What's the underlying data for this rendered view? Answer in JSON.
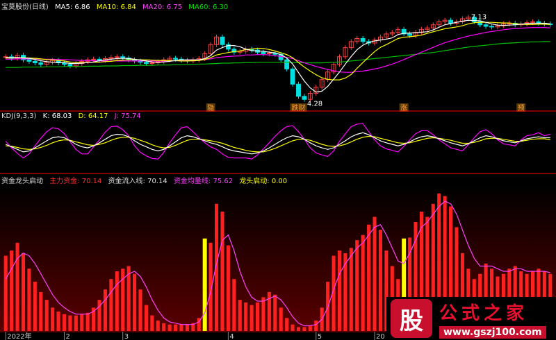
{
  "colors": {
    "up": "#ff4040",
    "down": "#00e0e0",
    "ma5": "#ffffff",
    "ma10": "#ffff00",
    "ma20": "#ff00ff",
    "ma60": "#00c000",
    "fund_bar": "#ff2020",
    "fund_line": "#ff40ff",
    "dragon": "#ffff00",
    "divider": "#ff0000"
  },
  "main_header": {
    "stock": "宝莫股份(日线)",
    "ma5": "MA5: 6.86",
    "ma10": "MA10: 6.84",
    "ma20": "MA20: 6.75",
    "ma60": "MA60: 6.30"
  },
  "kdj_header": {
    "name": "KDJ(9,3,3)",
    "k": "K: 68.03",
    "d": "D: 64.17",
    "j": "J: 75.74"
  },
  "fund_header": {
    "name": "资金龙头启动",
    "main": "主力资金: 70.14",
    "inflow": "资金流入线: 70.14",
    "avg": "资金均量线: 75.62",
    "dragon": "龙头启动: 0.00"
  },
  "watermark": {
    "logo_char": "股",
    "brand": "公式之家",
    "url": "www.gszj100.com"
  },
  "chart_data": [
    {
      "type": "line",
      "name": "price",
      "close": [
        5.8,
        5.75,
        5.85,
        5.7,
        5.65,
        5.6,
        5.55,
        5.62,
        5.68,
        5.6,
        5.55,
        5.5,
        5.58,
        5.65,
        5.7,
        5.72,
        5.68,
        5.74,
        5.78,
        5.8,
        5.76,
        5.7,
        5.66,
        5.62,
        5.58,
        5.6,
        5.64,
        5.7,
        5.75,
        5.72,
        5.68,
        5.66,
        5.7,
        5.74,
        5.9,
        6.2,
        6.45,
        6.2,
        6.05,
        5.95,
        5.98,
        6.05,
        6.02,
        5.95,
        5.9,
        5.92,
        5.88,
        5.7,
        5.4,
        4.9,
        4.5,
        4.4,
        4.6,
        4.8,
        5.05,
        5.3,
        5.55,
        5.8,
        6.1,
        6.3,
        6.4,
        6.3,
        6.25,
        6.35,
        6.45,
        6.55,
        6.6,
        6.7,
        6.55,
        6.5,
        6.6,
        6.7,
        6.75,
        6.85,
        6.95,
        7.0,
        6.9,
        6.95,
        7.05,
        7.1,
        6.95,
        6.85,
        6.8,
        6.78,
        6.82,
        6.88,
        6.9,
        6.85,
        6.88,
        6.92,
        6.95,
        6.9,
        6.88,
        6.86
      ],
      "ma5": [
        5.78,
        5.77,
        5.78,
        5.76,
        5.75,
        5.71,
        5.67,
        5.64,
        5.62,
        5.61,
        5.61,
        5.58,
        5.58,
        5.59,
        5.61,
        5.63,
        5.67,
        5.7,
        5.72,
        5.74,
        5.75,
        5.74,
        5.72,
        5.69,
        5.66,
        5.63,
        5.62,
        5.63,
        5.65,
        5.68,
        5.7,
        5.7,
        5.7,
        5.7,
        5.74,
        5.84,
        6.02,
        6.1,
        6.17,
        6.17,
        6.13,
        6.05,
        6.0,
        5.99,
        5.98,
        5.95,
        5.93,
        5.87,
        5.76,
        5.56,
        5.28,
        5.0,
        4.78,
        4.64,
        4.67,
        4.83,
        5.06,
        5.3,
        5.56,
        5.81,
        6.03,
        6.18,
        6.27,
        6.32,
        6.35,
        6.38,
        6.42,
        6.53,
        6.57,
        6.58,
        6.59,
        6.61,
        6.62,
        6.68,
        6.77,
        6.85,
        6.89,
        6.93,
        6.97,
        7.0,
        6.99,
        6.98,
        6.93,
        6.88,
        6.84,
        6.83,
        6.84,
        6.85,
        6.87,
        6.89,
        6.9,
        6.9,
        6.9,
        6.88
      ],
      "ma10": [
        5.76,
        5.76,
        5.77,
        5.77,
        5.76,
        5.75,
        5.73,
        5.71,
        5.7,
        5.68,
        5.66,
        5.63,
        5.61,
        5.61,
        5.61,
        5.62,
        5.62,
        5.64,
        5.65,
        5.68,
        5.69,
        5.7,
        5.71,
        5.7,
        5.7,
        5.69,
        5.68,
        5.68,
        5.67,
        5.67,
        5.66,
        5.66,
        5.67,
        5.68,
        5.71,
        5.77,
        5.86,
        5.9,
        5.94,
        5.97,
        5.99,
        6.04,
        6.05,
        6.08,
        6.07,
        6.04,
        5.99,
        5.93,
        5.87,
        5.77,
        5.61,
        5.46,
        5.33,
        5.21,
        5.11,
        5.06,
        5.04,
        5.04,
        5.1,
        5.22,
        5.42,
        5.61,
        5.79,
        5.97,
        6.11,
        6.2,
        6.3,
        6.4,
        6.44,
        6.46,
        6.48,
        6.51,
        6.57,
        6.62,
        6.67,
        6.72,
        6.75,
        6.78,
        6.82,
        6.88,
        6.92,
        6.93,
        6.93,
        6.93,
        6.92,
        6.91,
        6.91,
        6.89,
        6.87,
        6.86,
        6.86,
        6.87,
        6.87,
        6.86
      ],
      "ma20": [
        5.72,
        5.72,
        5.73,
        5.73,
        5.73,
        5.73,
        5.72,
        5.72,
        5.72,
        5.71,
        5.71,
        5.7,
        5.69,
        5.68,
        5.68,
        5.67,
        5.66,
        5.66,
        5.66,
        5.66,
        5.66,
        5.66,
        5.66,
        5.66,
        5.66,
        5.66,
        5.66,
        5.66,
        5.66,
        5.67,
        5.67,
        5.68,
        5.69,
        5.7,
        5.71,
        5.73,
        5.77,
        5.79,
        5.81,
        5.82,
        5.83,
        5.86,
        5.86,
        5.87,
        5.87,
        5.86,
        5.84,
        5.81,
        5.78,
        5.74,
        5.67,
        5.6,
        5.54,
        5.48,
        5.43,
        5.38,
        5.34,
        5.3,
        5.29,
        5.29,
        5.31,
        5.33,
        5.36,
        5.4,
        5.44,
        5.5,
        5.56,
        5.63,
        5.71,
        5.79,
        5.87,
        5.95,
        6.03,
        6.11,
        6.19,
        6.26,
        6.32,
        6.38,
        6.43,
        6.48,
        6.52,
        6.56,
        6.6,
        6.63,
        6.66,
        6.69,
        6.71,
        6.73,
        6.74,
        6.75,
        6.76,
        6.76,
        6.76,
        6.75
      ],
      "ma60": [
        5.45,
        5.45,
        5.45,
        5.46,
        5.46,
        5.46,
        5.46,
        5.47,
        5.47,
        5.47,
        5.48,
        5.48,
        5.48,
        5.48,
        5.49,
        5.49,
        5.49,
        5.5,
        5.5,
        5.5,
        5.51,
        5.51,
        5.51,
        5.52,
        5.52,
        5.52,
        5.53,
        5.53,
        5.53,
        5.54,
        5.54,
        5.55,
        5.55,
        5.56,
        5.56,
        5.57,
        5.58,
        5.59,
        5.59,
        5.6,
        5.6,
        5.61,
        5.61,
        5.62,
        5.62,
        5.62,
        5.62,
        5.62,
        5.62,
        5.61,
        5.61,
        5.6,
        5.6,
        5.6,
        5.6,
        5.61,
        5.62,
        5.63,
        5.64,
        5.66,
        5.68,
        5.7,
        5.72,
        5.74,
        5.76,
        5.78,
        5.8,
        5.82,
        5.84,
        5.86,
        5.88,
        5.9,
        5.92,
        5.94,
        5.97,
        6.0,
        6.03,
        6.06,
        6.09,
        6.12,
        6.14,
        6.16,
        6.18,
        6.2,
        6.22,
        6.24,
        6.25,
        6.26,
        6.27,
        6.28,
        6.29,
        6.29,
        6.3,
        6.3
      ],
      "ylim": [
        4.2,
        7.3
      ],
      "annotations": [
        {
          "text": "7.13",
          "index": 79,
          "value": 7.13
        },
        {
          "text": "4.28",
          "index": 51,
          "value": 4.28
        }
      ],
      "event_labels": [
        {
          "text": "隐",
          "index": 35
        },
        {
          "text": "跌财",
          "index": 50
        },
        {
          "text": "涨",
          "index": 68
        },
        {
          "text": "预",
          "index": 88
        }
      ]
    },
    {
      "type": "line",
      "name": "kdj",
      "k": [
        55,
        50,
        45,
        40,
        42,
        48,
        55,
        62,
        68,
        70,
        68,
        62,
        55,
        50,
        48,
        52,
        58,
        65,
        72,
        75,
        74,
        70,
        62,
        55,
        50,
        45,
        42,
        45,
        52,
        60,
        68,
        72,
        70,
        66,
        62,
        58,
        55,
        50,
        45,
        42,
        40,
        38,
        36,
        38,
        42,
        48,
        55,
        62,
        68,
        72,
        70,
        65,
        58,
        52,
        48,
        45,
        48,
        55,
        62,
        70,
        75,
        78,
        74,
        68,
        62,
        58,
        55,
        52,
        55,
        60,
        66,
        70,
        72,
        70,
        66,
        62,
        58,
        55,
        52,
        56,
        62,
        68,
        72,
        70,
        66,
        62,
        60,
        58,
        62,
        66,
        68,
        70,
        68,
        68
      ],
      "d": [
        52,
        51,
        49,
        46,
        45,
        46,
        49,
        53,
        58,
        62,
        64,
        63,
        60,
        57,
        54,
        53,
        55,
        58,
        63,
        67,
        69,
        69,
        67,
        63,
        59,
        54,
        50,
        48,
        49,
        53,
        58,
        63,
        65,
        65,
        64,
        62,
        60,
        57,
        53,
        49,
        46,
        43,
        41,
        40,
        40,
        43,
        47,
        52,
        57,
        62,
        65,
        65,
        63,
        59,
        55,
        52,
        51,
        52,
        55,
        60,
        65,
        69,
        71,
        70,
        67,
        64,
        61,
        58,
        57,
        58,
        61,
        64,
        67,
        68,
        67,
        65,
        63,
        60,
        57,
        57,
        59,
        62,
        66,
        67,
        67,
        65,
        63,
        61,
        61,
        63,
        65,
        66,
        66,
        64
      ],
      "j": [
        61,
        48,
        37,
        28,
        36,
        52,
        67,
        80,
        88,
        86,
        76,
        60,
        45,
        36,
        36,
        50,
        64,
        79,
        90,
        91,
        84,
        72,
        52,
        39,
        32,
        27,
        26,
        39,
        58,
        74,
        88,
        90,
        80,
        68,
        58,
        50,
        45,
        36,
        29,
        28,
        28,
        28,
        26,
        34,
        46,
        58,
        71,
        82,
        90,
        92,
        80,
        65,
        48,
        38,
        34,
        31,
        42,
        61,
        76,
        90,
        95,
        96,
        80,
        64,
        52,
        46,
        43,
        40,
        51,
        64,
        76,
        82,
        82,
        74,
        64,
        56,
        48,
        45,
        42,
        54,
        68,
        80,
        84,
        76,
        64,
        56,
        54,
        52,
        64,
        72,
        74,
        78,
        72,
        75
      ],
      "ylim": [
        0,
        110
      ]
    },
    {
      "type": "bar",
      "name": "fund",
      "main_fund": [
        58,
        62,
        68,
        60,
        48,
        38,
        30,
        24,
        18,
        15,
        13,
        12,
        12,
        13,
        14,
        18,
        24,
        32,
        40,
        46,
        48,
        50,
        44,
        32,
        20,
        12,
        8,
        6,
        5,
        5,
        5,
        5,
        6,
        10,
        32,
        68,
        98,
        92,
        66,
        40,
        24,
        22,
        20,
        22,
        26,
        30,
        28,
        18,
        10,
        5,
        3,
        3,
        4,
        8,
        18,
        38,
        58,
        62,
        60,
        64,
        70,
        74,
        82,
        88,
        78,
        62,
        50,
        40,
        52,
        72,
        84,
        92,
        88,
        98,
        106,
        104,
        96,
        80,
        60,
        48,
        40,
        44,
        52,
        48,
        42,
        44,
        48,
        50,
        46,
        44,
        46,
        48,
        46,
        44
      ],
      "inflow_line": [
        40,
        48,
        56,
        60,
        58,
        52,
        44,
        36,
        28,
        22,
        18,
        15,
        13,
        13,
        13,
        15,
        19,
        24,
        30,
        36,
        40,
        44,
        46,
        42,
        34,
        24,
        16,
        10,
        7,
        6,
        5,
        5,
        5,
        7,
        14,
        30,
        52,
        70,
        74,
        62,
        46,
        34,
        26,
        23,
        23,
        25,
        27,
        24,
        18,
        11,
        6,
        4,
        4,
        5,
        9,
        18,
        32,
        44,
        52,
        58,
        64,
        68,
        74,
        80,
        82,
        74,
        64,
        54,
        52,
        60,
        70,
        80,
        84,
        90,
        96,
        100,
        98,
        90,
        78,
        66,
        56,
        50,
        50,
        50,
        48,
        46,
        46,
        48,
        48,
        46,
        46,
        46,
        46,
        45
      ],
      "dragon_start": [
        0,
        0,
        0,
        0,
        0,
        0,
        0,
        0,
        0,
        0,
        0,
        0,
        0,
        0,
        0,
        0,
        0,
        0,
        0,
        0,
        0,
        0,
        0,
        0,
        0,
        0,
        0,
        0,
        0,
        0,
        0,
        0,
        0,
        0,
        1,
        0,
        0,
        0,
        0,
        0,
        0,
        0,
        0,
        0,
        0,
        0,
        0,
        0,
        0,
        0,
        0,
        0,
        0,
        0,
        0,
        0,
        0,
        0,
        0,
        0,
        0,
        0,
        0,
        0,
        0,
        0,
        0,
        0,
        1,
        0,
        0,
        0,
        0,
        0,
        0,
        0,
        0,
        0,
        0,
        0,
        0,
        0,
        0,
        0,
        0,
        0,
        0,
        0,
        0,
        0,
        0,
        0,
        0,
        0
      ],
      "ylim": [
        0,
        115
      ]
    }
  ],
  "x_axis": {
    "ticks": [
      {
        "label": "2022年",
        "index": 0
      },
      {
        "label": "2",
        "index": 10
      },
      {
        "label": "3",
        "index": 20
      },
      {
        "label": "4",
        "index": 38
      },
      {
        "label": "5",
        "index": 53
      },
      {
        "label": "20",
        "index": 63
      }
    ]
  }
}
